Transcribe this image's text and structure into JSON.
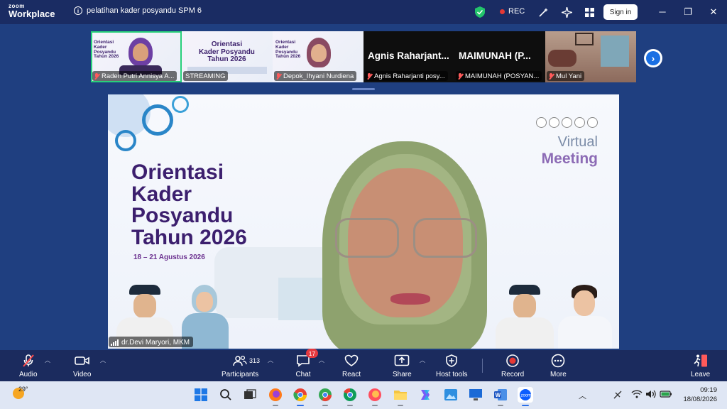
{
  "app": {
    "logo_line1": "zoom",
    "logo_line2": "Workplace"
  },
  "meeting": {
    "title": "pelatihan kader posyandu SPM 6",
    "rec_label": "REC",
    "signin_label": "Sign in"
  },
  "gallery": {
    "tiles": [
      {
        "name": "Raden Putri Annisya A..."
      },
      {
        "name": "STREAMING"
      },
      {
        "name": "Depok_Ihyani Nurdiena"
      },
      {
        "name": "Agnis Raharjanti posy...",
        "big_name": "Agnis Raharjant..."
      },
      {
        "name": "MAIMUNAH (POSYAN...",
        "big_name": "MAIMUNAH (P..."
      },
      {
        "name": "Mul Yani"
      }
    ]
  },
  "main_video": {
    "slide_title_lines": [
      "Orientasi",
      "Kader",
      "Posyandu",
      "Tahun 2026"
    ],
    "slide_date": "18 – 21 Agustus 2026",
    "virtual_line1": "Virtual",
    "virtual_line2": "Meeting",
    "speaker_name": "dr.Devi Maryori, MKM"
  },
  "mini_slide": {
    "title_lines": [
      "Orientasi",
      "Kader",
      "Posyandu",
      "Tahun 2026"
    ]
  },
  "mini_slide_big": {
    "title_lines": [
      "Orientasi",
      "Kader Posyandu",
      "Tahun 2026"
    ]
  },
  "toolbar": {
    "audio": "Audio",
    "video": "Video",
    "participants": "Participants",
    "participants_count": "313",
    "chat": "Chat",
    "chat_badge": "17",
    "react": "React",
    "share": "Share",
    "host_tools": "Host tools",
    "record": "Record",
    "more": "More",
    "leave": "Leave"
  },
  "taskbar": {
    "temperature": "29°",
    "time": "09:19",
    "date": "18/08/2026"
  },
  "colors": {
    "accent_green": "#28d07a",
    "rec_red": "#e53935",
    "title_purple": "#3c1f6e",
    "zoom_blue": "#1a6fe3"
  }
}
